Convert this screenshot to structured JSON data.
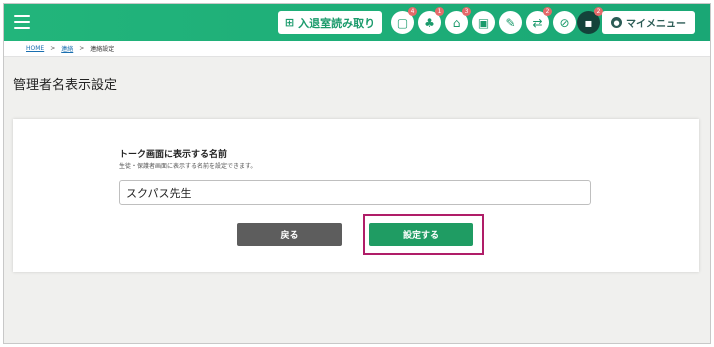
{
  "header": {
    "qr_button_label": "入退室読み取り",
    "icons": [
      {
        "name": "chat-icon",
        "glyph": "▢",
        "badge": "4"
      },
      {
        "name": "group-icon",
        "glyph": "♣",
        "badge": "1"
      },
      {
        "name": "school-icon",
        "glyph": "⌂",
        "badge": "3"
      },
      {
        "name": "gift-icon",
        "glyph": "▣",
        "badge": ""
      },
      {
        "name": "note-icon",
        "glyph": "✎",
        "badge": ""
      },
      {
        "name": "transfer-icon",
        "glyph": "⇄",
        "badge": "2"
      },
      {
        "name": "blocked-icon",
        "glyph": "⊘",
        "badge": ""
      },
      {
        "name": "message-icon",
        "glyph": "▪",
        "badge": "2"
      }
    ],
    "my_menu_label": "マイメニュー"
  },
  "breadcrumb": {
    "home": "HOME",
    "section": "連絡",
    "current": "連絡設定",
    "separator": ">"
  },
  "page": {
    "title": "管理者名表示設定"
  },
  "form": {
    "label": "トーク画面に表示する名前",
    "help": "生徒・保護者画面に表示する名前を設定できます。",
    "name_value": "スクパス先生",
    "back_label": "戻る",
    "save_label": "設定する"
  },
  "colors": {
    "brand_green": "#22b57b",
    "save_green": "#1f9c63",
    "back_gray": "#5d5d5d",
    "highlight": "#b01d68",
    "badge_red": "#e46a6a"
  }
}
